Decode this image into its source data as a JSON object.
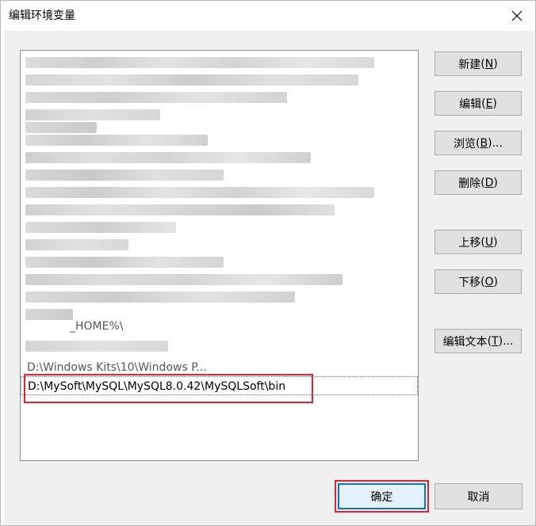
{
  "window": {
    "title": "编辑环境变量",
    "close_symbol": "✕"
  },
  "list": {
    "partial_item": "D:\\Windows Kits\\10\\Windows P...",
    "partial_item_2": "_HOME%\\",
    "selected_item": "D:\\MySoft\\MySQL\\MySQL8.0.42\\MySQLSoft\\bin"
  },
  "side_buttons": [
    {
      "label": "新建",
      "key": "N"
    },
    {
      "label": "编辑",
      "key": "E"
    },
    {
      "label": "浏览",
      "key": "B",
      "suffix": "..."
    },
    {
      "label": "删除",
      "key": "D"
    },
    {
      "label": "上移",
      "key": "U"
    },
    {
      "label": "下移",
      "key": "O"
    },
    {
      "label": "编辑文本",
      "key": "T",
      "suffix": "..."
    }
  ],
  "footer": {
    "ok_label": "确定",
    "cancel_label": "取消"
  },
  "colors": {
    "highlight_red": "#e8202a",
    "focus_blue": "#0078d7"
  }
}
